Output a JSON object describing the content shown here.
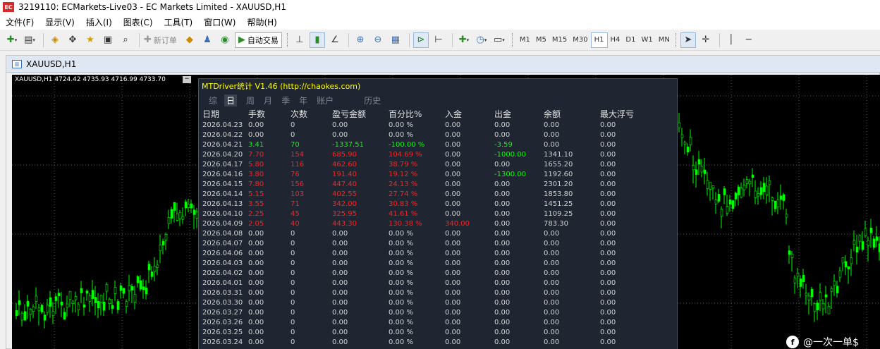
{
  "window": {
    "app_icon": "EC",
    "title": "3219110: ECMarkets-Live03 - EC Markets Limited - XAUUSD,H1"
  },
  "menu": [
    "文件(F)",
    "显示(V)",
    "插入(I)",
    "图表(C)",
    "工具(T)",
    "窗口(W)",
    "帮助(H)"
  ],
  "toolbar": {
    "new_order": "新订单",
    "auto_trade": "自动交易",
    "timeframes": [
      "M1",
      "M5",
      "M15",
      "M30",
      "H1",
      "H4",
      "D1",
      "W1",
      "MN"
    ],
    "active_timeframe": "H1"
  },
  "chart": {
    "tab_title": "XAUUSD,H1",
    "ohlc": "XAUUSD,H1  4724.42 4735.93 4716.99 4733.70",
    "candle_color": "#00ff00",
    "background": "#000000"
  },
  "panel": {
    "title": "MTDriver统计 V1.46  (http://chaokes.com)",
    "tabs": [
      "综",
      "日",
      "周",
      "月",
      "季",
      "年",
      "账户",
      "历史"
    ],
    "active_tab": "日",
    "columns": [
      "日期",
      "手数",
      "次数",
      "盈亏金额",
      "百分比%",
      "入金",
      "出金",
      "余额",
      "最大浮亏"
    ],
    "rows": [
      {
        "cells": [
          "2026.04.23",
          "0.00",
          "0",
          "0.00",
          "0.00 %",
          "0.00",
          "0.00",
          "0.00",
          "0.00"
        ],
        "tone": "white"
      },
      {
        "cells": [
          "2026.04.22",
          "0.00",
          "0",
          "0.00",
          "0.00 %",
          "0.00",
          "0.00",
          "0.00",
          "0.00"
        ],
        "tone": "white"
      },
      {
        "cells": [
          "2026.04.21",
          "3.41",
          "70",
          "-1337.51",
          "-100.00 %",
          "0.00",
          "-3.59",
          "0.00",
          "0.00"
        ],
        "tone": "green"
      },
      {
        "cells": [
          "2026.04.20",
          "7.70",
          "154",
          "685.90",
          "104.69 %",
          "0.00",
          "-1000.00",
          "1341.10",
          "0.00"
        ],
        "tone": "red"
      },
      {
        "cells": [
          "2026.04.17",
          "5.80",
          "116",
          "462.60",
          "38.79 %",
          "0.00",
          "0.00",
          "1655.20",
          "0.00"
        ],
        "tone": "red"
      },
      {
        "cells": [
          "2026.04.16",
          "3.80",
          "76",
          "191.40",
          "19.12 %",
          "0.00",
          "-1300.00",
          "1192.60",
          "0.00"
        ],
        "tone": "red"
      },
      {
        "cells": [
          "2026.04.15",
          "7.80",
          "156",
          "447.40",
          "24.13 %",
          "0.00",
          "0.00",
          "2301.20",
          "0.00"
        ],
        "tone": "red"
      },
      {
        "cells": [
          "2026.04.14",
          "5.15",
          "103",
          "402.55",
          "27.74 %",
          "0.00",
          "0.00",
          "1853.80",
          "0.00"
        ],
        "tone": "red"
      },
      {
        "cells": [
          "2026.04.13",
          "3.55",
          "71",
          "342.00",
          "30.83 %",
          "0.00",
          "0.00",
          "1451.25",
          "0.00"
        ],
        "tone": "red"
      },
      {
        "cells": [
          "2026.04.10",
          "2.25",
          "45",
          "325.95",
          "41.61 %",
          "0.00",
          "0.00",
          "1109.25",
          "0.00"
        ],
        "tone": "red"
      },
      {
        "cells": [
          "2026.04.09",
          "2.05",
          "40",
          "443.30",
          "130.38 %",
          "340.00",
          "0.00",
          "783.30",
          "0.00"
        ],
        "tone": "red"
      },
      {
        "cells": [
          "2026.04.08",
          "0.00",
          "0",
          "0.00",
          "0.00 %",
          "0.00",
          "0.00",
          "0.00",
          "0.00"
        ],
        "tone": "white"
      },
      {
        "cells": [
          "2026.04.07",
          "0.00",
          "0",
          "0.00",
          "0.00 %",
          "0.00",
          "0.00",
          "0.00",
          "0.00"
        ],
        "tone": "white"
      },
      {
        "cells": [
          "2026.04.06",
          "0.00",
          "0",
          "0.00",
          "0.00 %",
          "0.00",
          "0.00",
          "0.00",
          "0.00"
        ],
        "tone": "white"
      },
      {
        "cells": [
          "2026.04.03",
          "0.00",
          "0",
          "0.00",
          "0.00 %",
          "0.00",
          "0.00",
          "0.00",
          "0.00"
        ],
        "tone": "white"
      },
      {
        "cells": [
          "2026.04.02",
          "0.00",
          "0",
          "0.00",
          "0.00 %",
          "0.00",
          "0.00",
          "0.00",
          "0.00"
        ],
        "tone": "white"
      },
      {
        "cells": [
          "2026.04.01",
          "0.00",
          "0",
          "0.00",
          "0.00 %",
          "0.00",
          "0.00",
          "0.00",
          "0.00"
        ],
        "tone": "white"
      },
      {
        "cells": [
          "2026.03.31",
          "0.00",
          "0",
          "0.00",
          "0.00 %",
          "0.00",
          "0.00",
          "0.00",
          "0.00"
        ],
        "tone": "white"
      },
      {
        "cells": [
          "2026.03.30",
          "0.00",
          "0",
          "0.00",
          "0.00 %",
          "0.00",
          "0.00",
          "0.00",
          "0.00"
        ],
        "tone": "white"
      },
      {
        "cells": [
          "2026.03.27",
          "0.00",
          "0",
          "0.00",
          "0.00 %",
          "0.00",
          "0.00",
          "0.00",
          "0.00"
        ],
        "tone": "white"
      },
      {
        "cells": [
          "2026.03.26",
          "0.00",
          "0",
          "0.00",
          "0.00 %",
          "0.00",
          "0.00",
          "0.00",
          "0.00"
        ],
        "tone": "white"
      },
      {
        "cells": [
          "2026.03.25",
          "0.00",
          "0",
          "0.00",
          "0.00 %",
          "0.00",
          "0.00",
          "0.00",
          "0.00"
        ],
        "tone": "white"
      },
      {
        "cells": [
          "2026.03.24",
          "0.00",
          "0",
          "0.00",
          "0.00 %",
          "0.00",
          "0.00",
          "0.00",
          "0.00"
        ],
        "tone": "white"
      }
    ]
  },
  "watermark": {
    "logo": "f",
    "text": "@一次一单$"
  }
}
